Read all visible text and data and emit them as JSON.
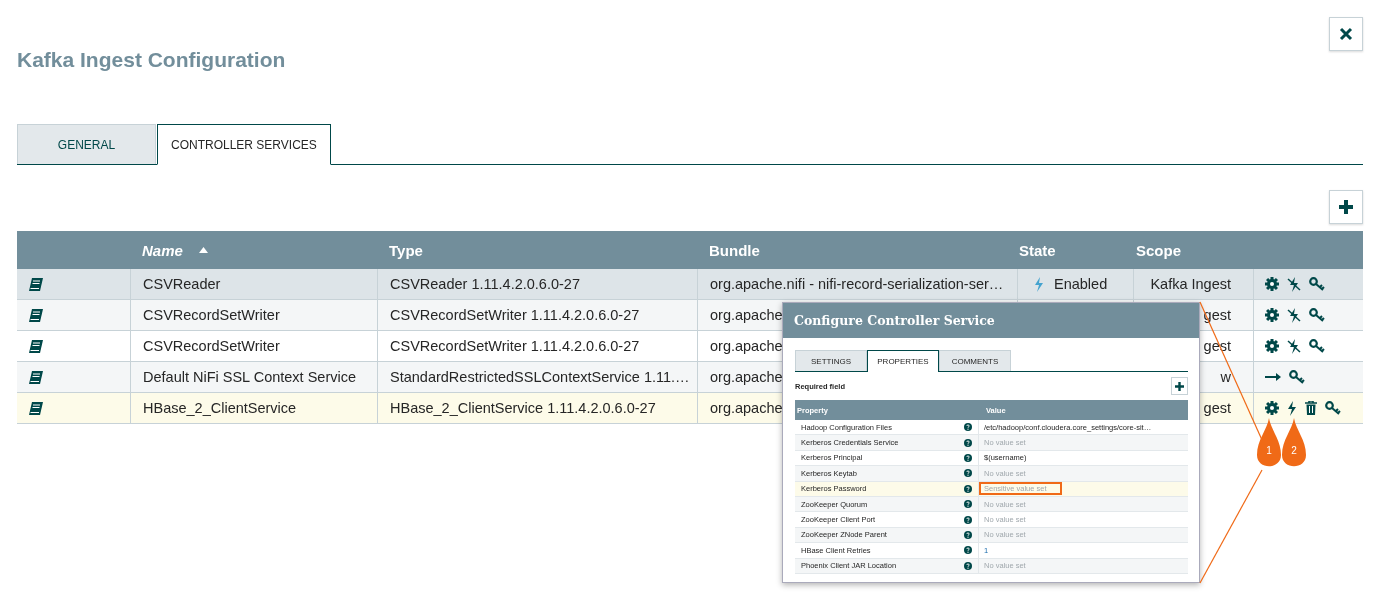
{
  "title": "Kafka Ingest Configuration",
  "tabs": [
    {
      "label": "GENERAL",
      "selected": false
    },
    {
      "label": "CONTROLLER SERVICES",
      "selected": true
    }
  ],
  "table": {
    "columns": [
      {
        "label": "Name",
        "sorted": true
      },
      {
        "label": "Type",
        "sorted": false
      },
      {
        "label": "Bundle",
        "sorted": false
      },
      {
        "label": "State",
        "sorted": false
      },
      {
        "label": "Scope",
        "sorted": false
      }
    ],
    "rows": [
      {
        "name": "CSVReader",
        "type": "CSVReader 1.11.4.2.0.6.0-27",
        "bundle": "org.apache.nifi - nifi-record-serialization-ser…",
        "state": "Enabled",
        "scope": "Kafka Ingest",
        "actions": [
          {
            "kind": "configure"
          },
          {
            "kind": "disable"
          },
          {
            "kind": "access"
          }
        ],
        "selected": false,
        "hovered": true
      },
      {
        "name": "CSVRecordSetWriter",
        "type": "CSVRecordSetWriter 1.11.4.2.0.6.0-27",
        "bundle": "org.apache",
        "scope": "gest",
        "actions": [
          {
            "kind": "configure"
          },
          {
            "kind": "disable"
          },
          {
            "kind": "access"
          }
        ],
        "selected": false,
        "hovered": false
      },
      {
        "name": "CSVRecordSetWriter",
        "type": "CSVRecordSetWriter 1.11.4.2.0.6.0-27",
        "bundle": "org.apache",
        "scope": "gest",
        "actions": [
          {
            "kind": "configure"
          },
          {
            "kind": "disable"
          },
          {
            "kind": "access"
          }
        ],
        "selected": false,
        "hovered": false
      },
      {
        "name": "Default NiFi SSL Context Service",
        "type": "StandardRestrictedSSLContextService 1.11.…",
        "bundle": "org.apache",
        "scope": "w",
        "actions": [
          {
            "kind": "goto"
          },
          {
            "kind": "access"
          }
        ],
        "selected": false,
        "hovered": false
      },
      {
        "name": "HBase_2_ClientService",
        "type": "HBase_2_ClientService 1.11.4.2.0.6.0-27",
        "bundle": "org.apache",
        "scope": "gest",
        "actions": [
          {
            "kind": "configure"
          },
          {
            "kind": "enable"
          },
          {
            "kind": "delete"
          },
          {
            "kind": "access"
          }
        ],
        "selected": true,
        "hovered": false
      }
    ]
  },
  "dialog": {
    "title": "Configure Controller Service",
    "tabs": [
      {
        "label": "SETTINGS",
        "selected": false
      },
      {
        "label": "PROPERTIES",
        "selected": true
      },
      {
        "label": "COMMENTS",
        "selected": false
      }
    ],
    "required_label": "Required field",
    "columns": [
      "Property",
      "Value"
    ],
    "properties": [
      {
        "name": "Hadoop Configuration Files",
        "value": "/etc/hadoop/conf.cloudera.core_settings/core-sit…",
        "kind": "set",
        "selected": false
      },
      {
        "name": "Kerberos Credentials Service",
        "value": "No value set",
        "kind": "empty",
        "selected": false
      },
      {
        "name": "Kerberos Principal",
        "value": "$(username)",
        "kind": "set",
        "selected": false
      },
      {
        "name": "Kerberos Keytab",
        "value": "No value set",
        "kind": "empty",
        "selected": false
      },
      {
        "name": "Kerberos Password",
        "value": "Sensitive value set",
        "kind": "sensitive",
        "selected": true
      },
      {
        "name": "ZooKeeper Quorum",
        "value": "No value set",
        "kind": "empty",
        "selected": false
      },
      {
        "name": "ZooKeeper Client Port",
        "value": "No value set",
        "kind": "empty",
        "selected": false
      },
      {
        "name": "ZooKeeper ZNode Parent",
        "value": "No value set",
        "kind": "empty",
        "selected": false
      },
      {
        "name": "HBase Client Retries",
        "value": "1",
        "kind": "number",
        "selected": false
      },
      {
        "name": "Phoenix Client JAR Location",
        "value": "No value set",
        "kind": "empty",
        "selected": false
      }
    ]
  },
  "annotations": [
    {
      "label": "1"
    },
    {
      "label": "2"
    }
  ]
}
